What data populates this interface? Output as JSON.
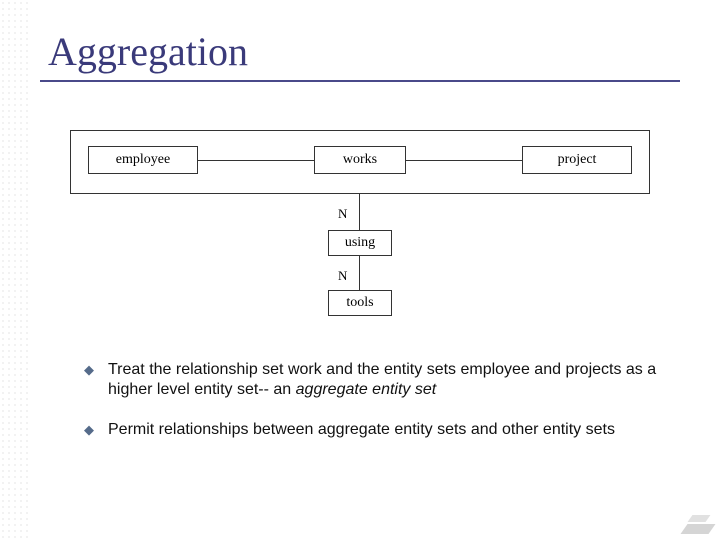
{
  "title": "Aggregation",
  "diagram": {
    "entities": {
      "employee": "employee",
      "works": "works",
      "project": "project",
      "using": "using",
      "tools": "tools"
    },
    "cardinality": {
      "n1": "N",
      "n2": "N"
    }
  },
  "bullets": [
    {
      "html": "Treat the relationship set work and the entity sets employee and projects as a higher level entity set-- an <em>aggregate entity set</em>"
    },
    {
      "html": "Permit relationships between aggregate entity sets and other entity sets"
    }
  ]
}
